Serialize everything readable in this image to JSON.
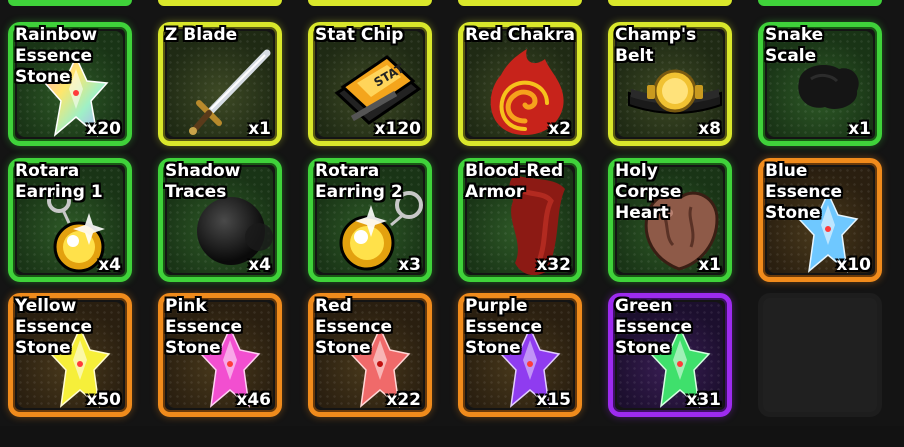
{
  "inventory": {
    "items": [
      {
        "name": "Rainbow\nEssence\nStone",
        "qty": "x20",
        "rarity": "green",
        "icon": "rainbow-crystal-icon"
      },
      {
        "name": "Z Blade",
        "qty": "x1",
        "rarity": "yellow",
        "icon": "sword-icon"
      },
      {
        "name": "Stat Chip",
        "qty": "x120",
        "rarity": "yellow",
        "icon": "stat-chip-icon",
        "chip_label": "STAT"
      },
      {
        "name": "Red Chakra",
        "qty": "x2",
        "rarity": "yellow",
        "icon": "red-chakra-icon"
      },
      {
        "name": "Champ's\nBelt",
        "qty": "x8",
        "rarity": "yellow",
        "icon": "champion-belt-icon"
      },
      {
        "name": "Snake Scale",
        "qty": "x1",
        "rarity": "green",
        "icon": "snake-scale-icon"
      },
      {
        "name": "Rotara\nEarring 1",
        "qty": "x4",
        "rarity": "green",
        "icon": "earring-icon"
      },
      {
        "name": "Shadow\nTraces",
        "qty": "x4",
        "rarity": "green",
        "icon": "shadow-orb-icon"
      },
      {
        "name": "Rotara\nEarring 2",
        "qty": "x3",
        "rarity": "green",
        "icon": "earring-icon"
      },
      {
        "name": "Blood-Red\nArmor",
        "qty": "x32",
        "rarity": "green",
        "icon": "blood-armor-icon"
      },
      {
        "name": "Holy\nCorpse\nHeart",
        "qty": "x1",
        "rarity": "green",
        "icon": "corpse-heart-icon"
      },
      {
        "name": "Blue\nEssence\nStone",
        "qty": "x10",
        "rarity": "orange",
        "icon": "blue-crystal-icon"
      },
      {
        "name": "Yellow\nEssence\nStone",
        "qty": "x50",
        "rarity": "orange",
        "icon": "yellow-crystal-icon"
      },
      {
        "name": "Pink\nEssence\nStone",
        "qty": "x46",
        "rarity": "orange",
        "icon": "pink-crystal-icon"
      },
      {
        "name": "Red\nEssence\nStone",
        "qty": "x22",
        "rarity": "orange",
        "icon": "red-crystal-icon"
      },
      {
        "name": "Purple\nEssence\nStone",
        "qty": "x15",
        "rarity": "orange",
        "icon": "purple-crystal-icon"
      },
      {
        "name": "Green\nEssence\nStone",
        "qty": "x31",
        "rarity": "purple",
        "icon": "green-crystal-icon"
      }
    ]
  },
  "colors": {
    "rarity_green": "#3fd23a",
    "rarity_yellow": "#d9e72b",
    "rarity_orange": "#f08b1c",
    "rarity_purple": "#9d2bef",
    "crystal_rainbow": "#f7a6c8",
    "crystal_blue": "#6fc8ff",
    "crystal_yellow": "#f6ef3a",
    "crystal_pink": "#f24fd0",
    "crystal_red": "#f06a6a",
    "crystal_purple": "#8f3cf0",
    "crystal_green": "#3fe06c"
  }
}
